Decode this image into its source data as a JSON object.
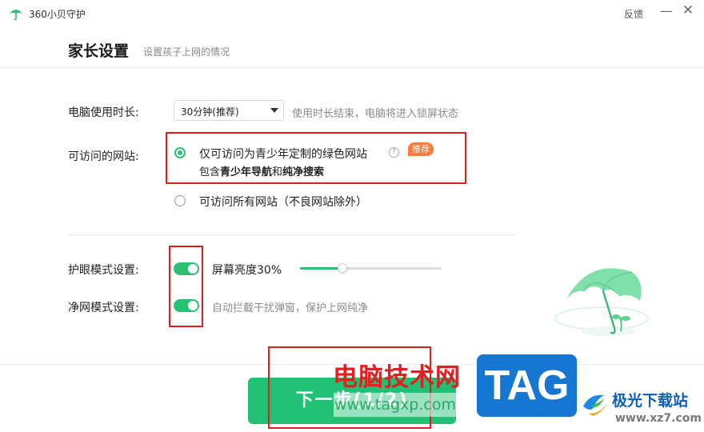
{
  "window": {
    "app_title": "360小贝守护",
    "feedback_label": "反馈",
    "minimize_glyph": "—",
    "close_glyph": "✕"
  },
  "header": {
    "title": "家长设置",
    "subtitle": "设置孩子上网的情况"
  },
  "usage": {
    "label": "电脑使用时长:",
    "selected_value": "30分钟(推荐)",
    "hint": "使用时长结束，电脑将进入锁屏状态"
  },
  "sites": {
    "label": "可访问的网站:",
    "options": [
      {
        "selected": true,
        "line1": "仅可访问为青少年定制的绿色网站",
        "badge": "推荐",
        "help_glyph": "?",
        "line2_prefix": "包含",
        "line2_bold1": "青少年导航",
        "line2_mid": "和",
        "line2_bold2": "纯净搜索"
      },
      {
        "selected": false,
        "line1": "可访问所有网站（不良网站除外）"
      }
    ]
  },
  "eye_mode": {
    "label": "护眼模式设置:",
    "enabled": true,
    "brightness_label": "屏幕亮度30%",
    "brightness": 0.3
  },
  "net_mode": {
    "label": "净网模式设置:",
    "enabled": true,
    "hint": "自动拦截干扰弹窗，保护上网纯净"
  },
  "footer": {
    "next_label": "下一步(1/2)"
  },
  "watermark": {
    "cn_text": "电脑技术网",
    "url": "www.tagxp.com",
    "tag": "TAG",
    "site_name": "极光下载站",
    "site_url": "www.xz7.com"
  },
  "colors": {
    "accent": "#2bbf74",
    "badge": "#ff7a3d",
    "annotation_box": "#e01e1e"
  },
  "icons": [
    "umbrella-app-icon",
    "chevron-down-icon",
    "help-icon",
    "umbrella-illustration"
  ]
}
